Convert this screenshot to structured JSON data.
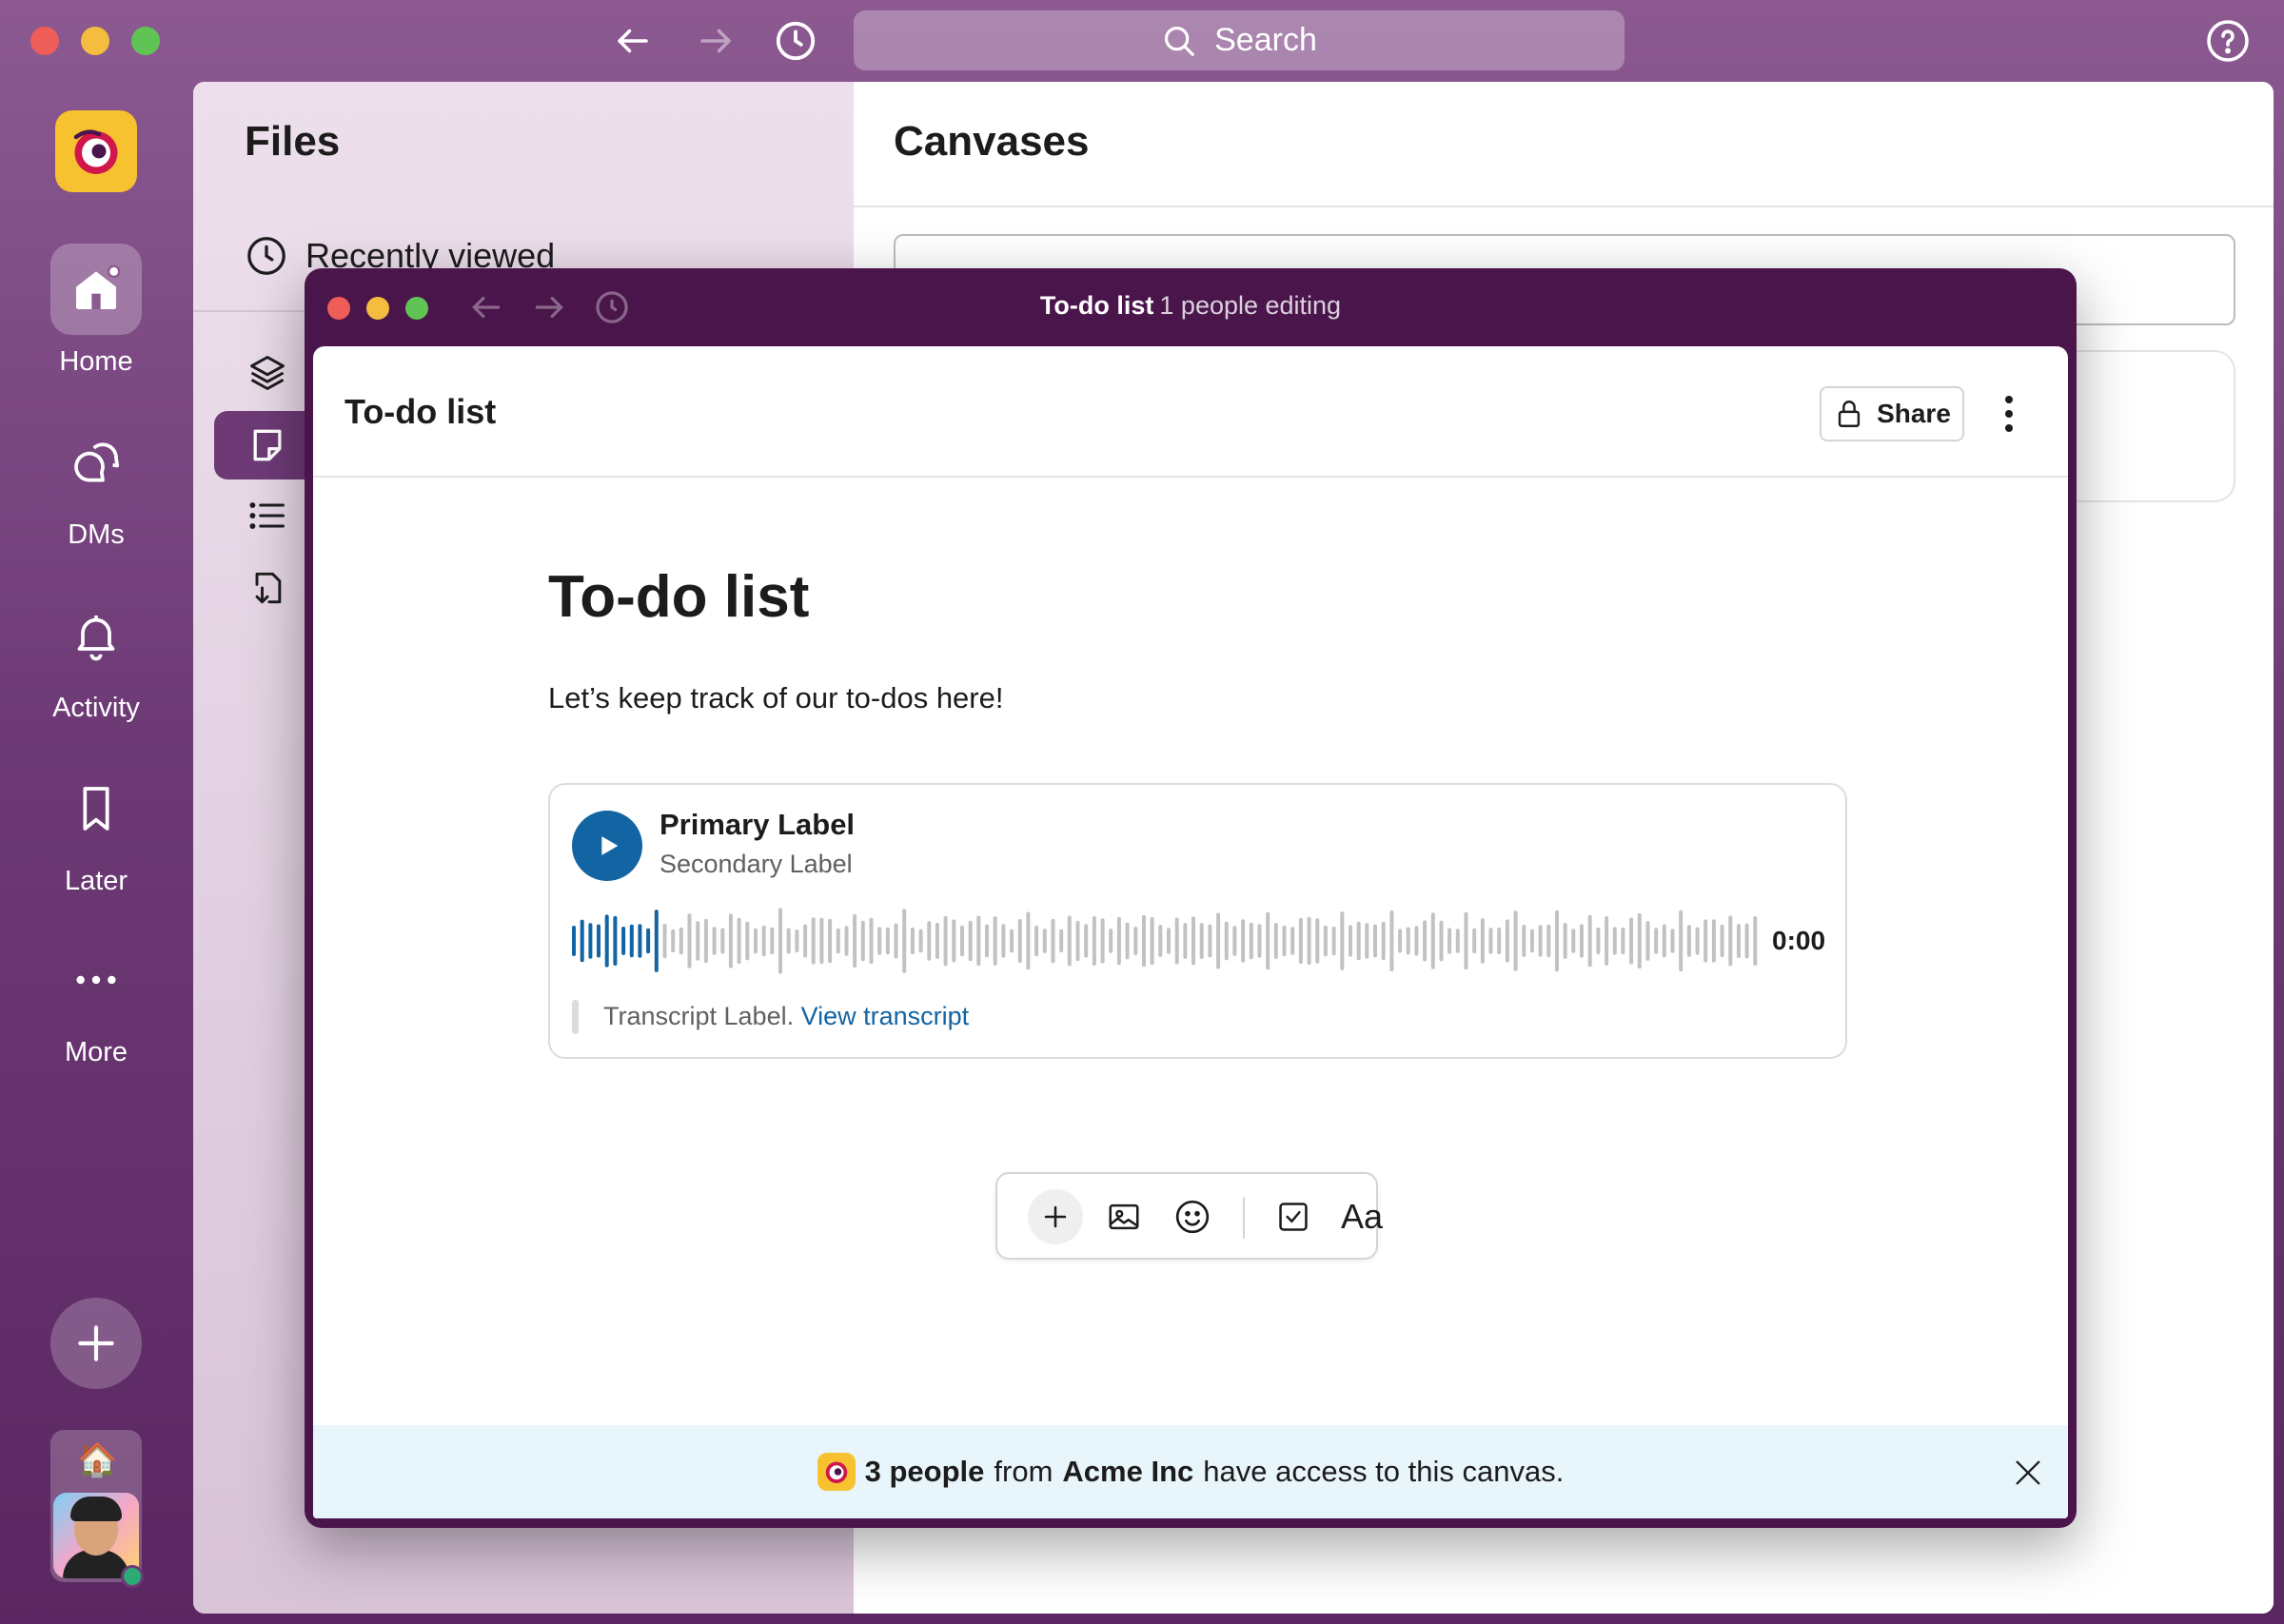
{
  "titlebar": {
    "search_label": "Search"
  },
  "rail": {
    "items": [
      {
        "label": "Home"
      },
      {
        "label": "DMs"
      },
      {
        "label": "Activity"
      },
      {
        "label": "Later"
      },
      {
        "label": "More"
      }
    ],
    "user_status_emoji": "🏠"
  },
  "files": {
    "title": "Files",
    "recent_label": "Recently viewed"
  },
  "canvases": {
    "title": "Canvases"
  },
  "canvas_window": {
    "title": "To-do list",
    "editing_status": "1 people editing",
    "header_title": "To-do list",
    "share_label": "Share",
    "doc_title": "To-do list",
    "doc_text": "Let’s keep track of our to-dos here!",
    "audio": {
      "primary_label": "Primary Label",
      "secondary_label": "Secondary Label",
      "time": "0:00",
      "progress_fraction": 0.07,
      "transcript_label": "Transcript Label.",
      "transcript_link": "View transcript"
    },
    "toolbar": {
      "plus": "+",
      "format_label": "Aa"
    },
    "banner": {
      "people": "3 people",
      "from": "from",
      "org": "Acme Inc",
      "suffix": "have access to this canvas."
    }
  },
  "colors": {
    "aubergine": "#4a154b",
    "link_blue": "#1264a3",
    "accent_yellow": "#f7c22f",
    "presence_green": "#2bac76"
  },
  "icons": [
    "back-arrow-icon",
    "forward-arrow-icon",
    "history-icon",
    "search-icon",
    "help-icon",
    "home-icon",
    "dms-icon",
    "bell-icon",
    "bookmark-icon",
    "more-icon",
    "plus-icon",
    "lock-icon",
    "play-icon",
    "image-icon",
    "emoji-icon",
    "checkbox-icon",
    "close-icon"
  ]
}
